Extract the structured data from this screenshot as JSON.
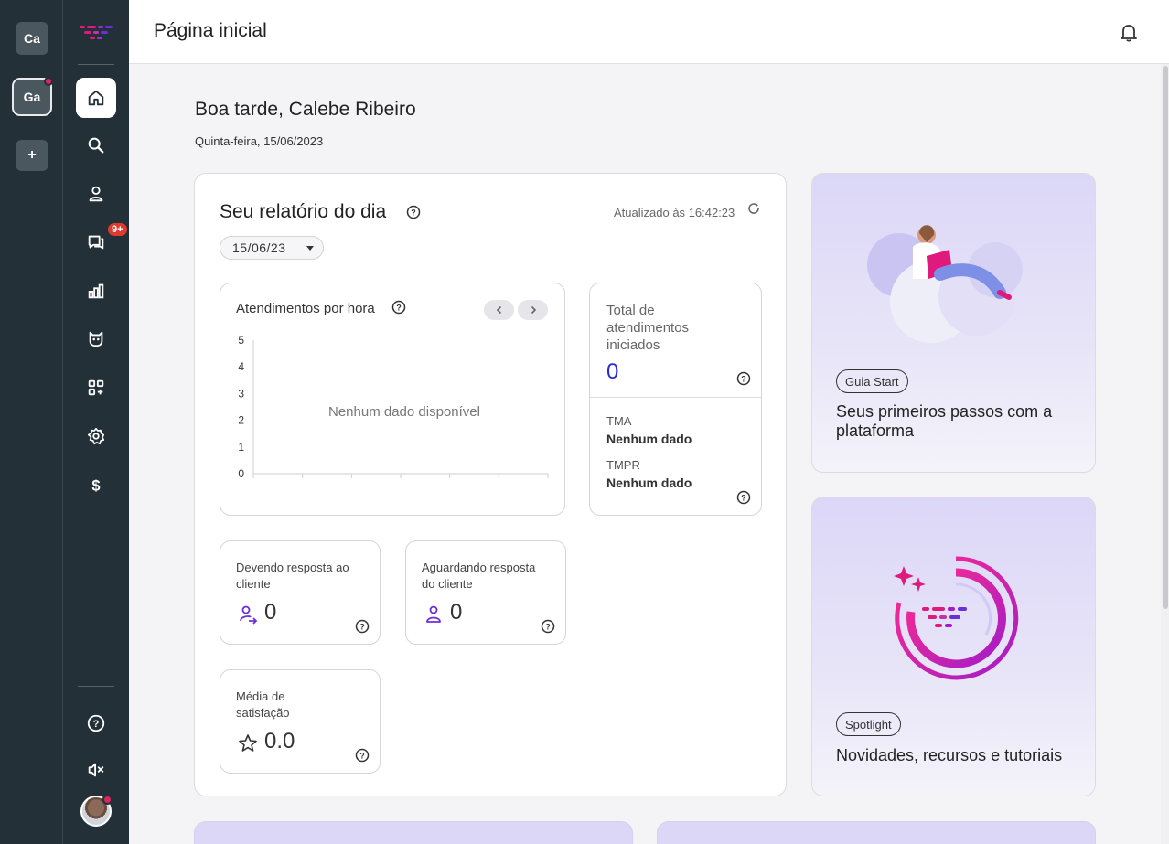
{
  "workspaces": [
    {
      "label": "Ca",
      "active": false,
      "notify": false
    },
    {
      "label": "Ga",
      "active": true,
      "notify": true
    },
    {
      "label": "+",
      "active": false,
      "notify": false
    }
  ],
  "nav": {
    "items": [
      {
        "icon": "home-icon",
        "active": true
      },
      {
        "icon": "search-icon"
      },
      {
        "icon": "contacts-icon"
      },
      {
        "icon": "chats-icon",
        "badge": "9+"
      },
      {
        "icon": "reports-icon"
      },
      {
        "icon": "bot-icon"
      },
      {
        "icon": "apps-icon"
      },
      {
        "icon": "settings-icon"
      },
      {
        "icon": "billing-icon"
      }
    ],
    "bottom": [
      {
        "icon": "help-icon"
      },
      {
        "icon": "mute-icon"
      }
    ]
  },
  "header": {
    "title": "Página inicial",
    "icon": "bell-icon"
  },
  "greeting": {
    "text": "Boa tarde, Calebe Ribeiro",
    "date": "Quinta-feira, 15/06/2023"
  },
  "report": {
    "title": "Seu relatório do dia",
    "updated": "Atualizado às 16:42:23",
    "date_selector": "15/06/23",
    "hourly": {
      "title": "Atendimentos por hora",
      "empty_text": "Nenhum dado disponível"
    },
    "total": {
      "label": "Total de atendimentos iniciados",
      "value": "0",
      "tma_label": "TMA",
      "tma_value": "Nenhum dado",
      "tmpr_label": "TMPR",
      "tmpr_value": "Nenhum dado"
    },
    "owing": {
      "label": "Devendo resposta ao cliente",
      "value": "0"
    },
    "awaiting": {
      "label": "Aguardando resposta do cliente",
      "value": "0"
    },
    "satisfaction": {
      "label": "Média de satisfação",
      "value": "0.0"
    }
  },
  "chart_data": {
    "type": "bar",
    "title": "Atendimentos por hora",
    "categories": [
      "",
      "",
      "",
      "",
      "",
      ""
    ],
    "values": [],
    "ylim": [
      0,
      5
    ],
    "yticks": [
      "0",
      "1",
      "2",
      "3",
      "4",
      "5"
    ],
    "grid": false
  },
  "side_cards": [
    {
      "tag": "Guia Start",
      "title": "Seus primeiros passos com a plataforma"
    },
    {
      "tag": "Spotlight",
      "title": "Novidades, recursos e tutoriais"
    }
  ],
  "colors": {
    "sidebar": "#233038",
    "accent": "#2b2bd6",
    "brand_pink": "#e0197d",
    "brand_purple": "#6b2fd6"
  }
}
